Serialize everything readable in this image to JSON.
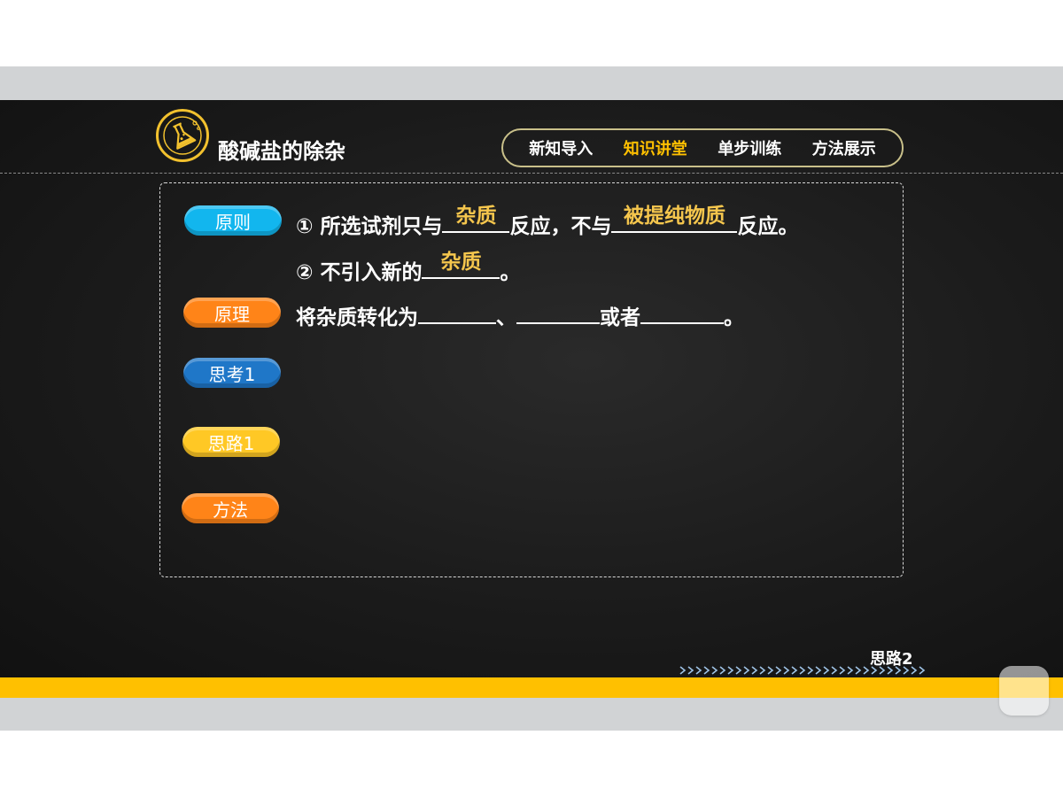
{
  "header": {
    "title": "酸碱盐的除杂",
    "logo_icon": "flask-icon"
  },
  "nav": [
    {
      "label": "新知导入"
    },
    {
      "label": "知识讲堂"
    },
    {
      "label": "单步训练"
    },
    {
      "label": "方法展示"
    }
  ],
  "sidebar": [
    {
      "label": "原则",
      "color": "#12b6ee"
    },
    {
      "label": "原理",
      "color": "#ff8418"
    },
    {
      "label": "思考1",
      "color": "#1f77c8"
    },
    {
      "label": "思路1",
      "color": "#ffc825"
    },
    {
      "label": "方法",
      "color": "#ff8418"
    }
  ],
  "content": {
    "principle_1": {
      "prefix": "① 所选试剂只与",
      "answer_1": "杂质",
      "middle": "反应，不与",
      "answer_2": "被提纯物质",
      "suffix": "反应。"
    },
    "principle_2": {
      "prefix": "② 不引入新的",
      "answer": "杂质",
      "suffix": "。"
    },
    "theory": {
      "prefix": "将杂质转化为",
      "sep_1": "、",
      "sep_2": "或者",
      "suffix": "。"
    }
  },
  "footer": {
    "next_label": "思路2"
  },
  "colors": {
    "accent": "#ffc000",
    "answer": "#f5c64d",
    "board": "#1b1b1b"
  }
}
